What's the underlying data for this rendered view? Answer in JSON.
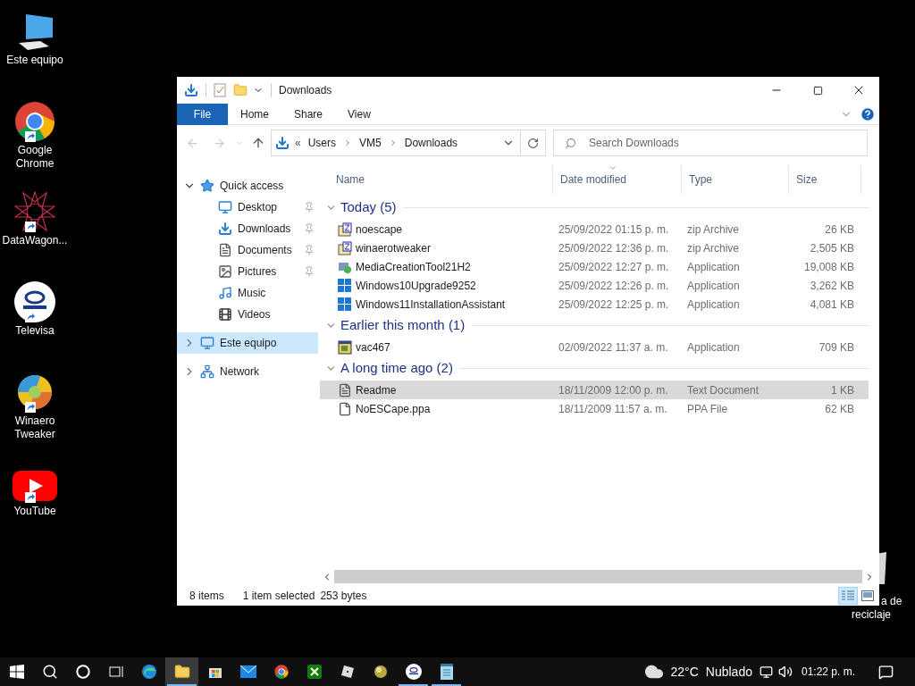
{
  "desktop_icons": [
    {
      "label": "Este equipo",
      "kind": "computer",
      "shortcut": false
    },
    {
      "label": "Google Chrome",
      "kind": "chrome",
      "shortcut": true
    },
    {
      "label": "DataWagon...",
      "kind": "star",
      "shortcut": true
    },
    {
      "label": "Televisa",
      "kind": "tv",
      "shortcut": true
    },
    {
      "label": "Winaero Tweaker",
      "kind": "swirl",
      "shortcut": true
    },
    {
      "label": "YouTube",
      "kind": "play",
      "shortcut": true
    }
  ],
  "recycle_bin": {
    "label_lines": [
      "a de",
      "reciclaje"
    ]
  },
  "window": {
    "title": "Downloads",
    "ribbon_tabs": [
      {
        "label": "File",
        "kind": "menu",
        "selected": false
      },
      {
        "label": "Home",
        "kind": "tab",
        "selected": false
      },
      {
        "label": "Share",
        "kind": "tab",
        "selected": false
      },
      {
        "label": "View",
        "kind": "tab",
        "selected": false
      }
    ],
    "address": {
      "overflow": "«",
      "path": [
        "Users",
        "VM5",
        "Downloads"
      ]
    },
    "search": {
      "placeholder": "Search Downloads"
    },
    "nav_pane": [
      {
        "label": "Quick access",
        "kind": "star",
        "expanded": true,
        "selected": false,
        "children": [
          {
            "label": "Desktop",
            "kind": "desktop",
            "pinned": true,
            "selected": false
          },
          {
            "label": "Downloads",
            "kind": "download",
            "pinned": true,
            "selected": false
          },
          {
            "label": "Documents",
            "kind": "document",
            "pinned": true,
            "selected": false
          },
          {
            "label": "Pictures",
            "kind": "picture",
            "pinned": true,
            "selected": false
          },
          {
            "label": "Music",
            "kind": "music",
            "pinned": false,
            "selected": false
          },
          {
            "label": "Videos",
            "kind": "video",
            "pinned": false,
            "selected": false
          }
        ]
      },
      {
        "label": "Este equipo",
        "kind": "computer",
        "expanded": false,
        "selected": true
      },
      {
        "label": "Network",
        "kind": "network",
        "expanded": false,
        "selected": false
      }
    ],
    "columns": [
      {
        "label": "Name",
        "sorted": false
      },
      {
        "label": "Date modified",
        "sorted": true
      },
      {
        "label": "Type",
        "sorted": false
      },
      {
        "label": "Size",
        "sorted": false
      }
    ],
    "groups": [
      {
        "title": "Today (5)",
        "expanded": true,
        "files": [
          {
            "name": "noescape",
            "date": "25/09/2022 01:15 p. m.",
            "type": "zip Archive",
            "size": "26 KB",
            "kind": "zip",
            "selected": false
          },
          {
            "name": "winaerotweaker",
            "date": "25/09/2022 12:36 p. m.",
            "type": "zip Archive",
            "size": "2,505 KB",
            "kind": "zip",
            "selected": false
          },
          {
            "name": "MediaCreationTool21H2",
            "date": "25/09/2022 12:27 p. m.",
            "type": "Application",
            "size": "19,008 KB",
            "kind": "setup",
            "selected": false
          },
          {
            "name": "Windows10Upgrade9252",
            "date": "25/09/2022 12:26 p. m.",
            "type": "Application",
            "size": "3,262 KB",
            "kind": "windows",
            "selected": false
          },
          {
            "name": "Windows11InstallationAssistant",
            "date": "25/09/2022 12:25 p. m.",
            "type": "Application",
            "size": "4,081 KB",
            "kind": "windows",
            "selected": false
          }
        ]
      },
      {
        "title": "Earlier this month (1)",
        "expanded": true,
        "files": [
          {
            "name": "vac467",
            "date": "02/09/2022 11:37 a. m.",
            "type": "Application",
            "size": "709 KB",
            "kind": "app",
            "selected": false
          }
        ]
      },
      {
        "title": "A long time ago (2)",
        "expanded": true,
        "files": [
          {
            "name": "Readme",
            "date": "18/11/2009 12:00 p. m.",
            "type": "Text Document",
            "size": "1 KB",
            "kind": "text",
            "selected": true
          },
          {
            "name": "NoESCape.ppa",
            "date": "18/11/2009 11:57 a. m.",
            "type": "PPA File",
            "size": "62 KB",
            "kind": "blank",
            "selected": false
          }
        ]
      }
    ],
    "status_bar": {
      "items": "8 items",
      "selection": "1 item selected",
      "size": "253 bytes",
      "views": [
        {
          "kind": "details",
          "selected": true
        },
        {
          "kind": "large",
          "selected": false
        }
      ]
    }
  },
  "taskbar": {
    "apps": [
      {
        "kind": "start",
        "running": false,
        "selected": false
      },
      {
        "kind": "search",
        "running": false,
        "selected": false
      },
      {
        "kind": "cortana",
        "running": false,
        "selected": false
      },
      {
        "kind": "taskview",
        "running": false,
        "selected": false
      },
      {
        "kind": "edge",
        "running": false,
        "selected": false
      },
      {
        "kind": "explorer",
        "running": true,
        "selected": true
      },
      {
        "kind": "store",
        "running": false,
        "selected": false
      },
      {
        "kind": "mail",
        "running": false,
        "selected": false
      },
      {
        "kind": "chrome",
        "running": false,
        "selected": false
      },
      {
        "kind": "xbox",
        "running": false,
        "selected": false
      },
      {
        "kind": "cube",
        "running": false,
        "selected": false
      },
      {
        "kind": "ball",
        "running": false,
        "selected": false
      },
      {
        "kind": "tv",
        "running": true,
        "selected": false
      },
      {
        "kind": "notepad",
        "running": true,
        "selected": false
      }
    ],
    "temperature": "22°C",
    "weather": "Nublado",
    "time": "01:22 p. m."
  }
}
